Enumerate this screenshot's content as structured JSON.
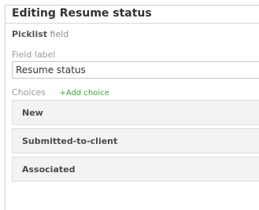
{
  "dialog": {
    "title": "Editing Resume status",
    "field_type": "Picklist",
    "field_type_suffix": "field"
  },
  "field_label": {
    "label": "Field label",
    "value": "Resume status"
  },
  "choices": {
    "label": "Choices",
    "add_label": "+Add choice",
    "items": [
      {
        "label": "New"
      },
      {
        "label": "Submitted-to-client"
      },
      {
        "label": "Associated"
      }
    ]
  }
}
